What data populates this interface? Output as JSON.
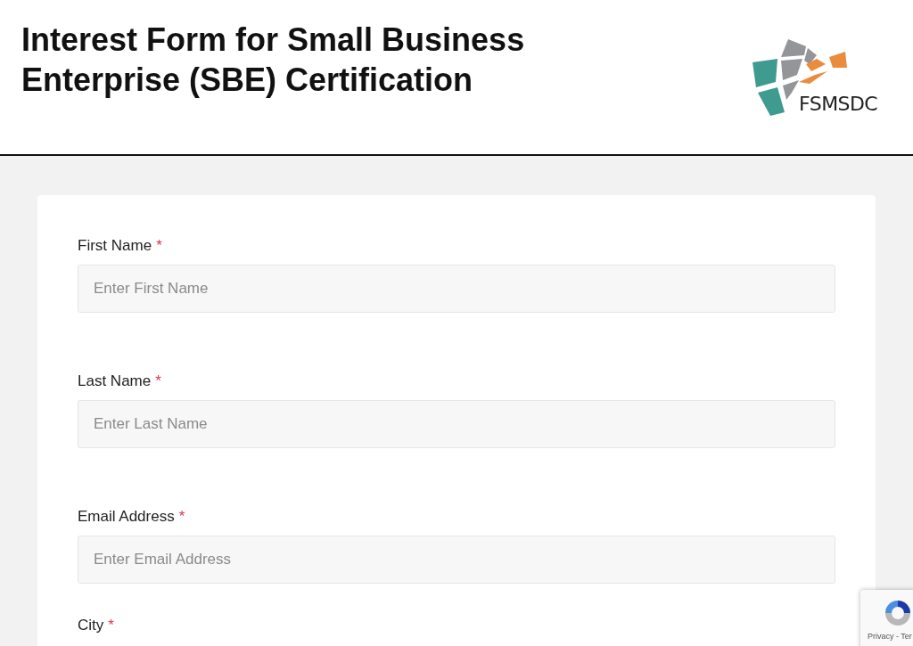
{
  "header": {
    "title": "Interest Form for Small Business Enterprise (SBE) Certification",
    "logo_text": "FSMSDC"
  },
  "fields": [
    {
      "label": "First Name",
      "required_mark": "*",
      "placeholder": "Enter First Name"
    },
    {
      "label": "Last Name",
      "required_mark": "*",
      "placeholder": "Enter Last Name"
    },
    {
      "label": "Email Address",
      "required_mark": "*",
      "placeholder": "Enter Email Address"
    },
    {
      "label": "City",
      "required_mark": "*"
    }
  ],
  "recaptcha": {
    "links": "Privacy - Ter"
  }
}
